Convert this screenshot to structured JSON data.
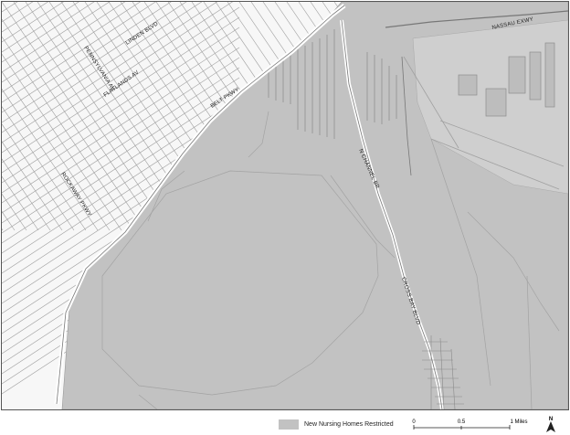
{
  "map": {
    "road_labels": {
      "linden": "LINDEN BLVD",
      "pennsylvania": "PENNSYLVANIA AV",
      "flatlands": "FLATLANDS AV",
      "belt": "BELT PKWY",
      "rockaway": "ROCKAWAY PKWY",
      "nassau": "NASSAU EXWY",
      "channel": "N CHANNEL BR",
      "crossbay": "CROSS BAY BLVD"
    },
    "colors": {
      "restricted_fill": "#c2c2c2",
      "land_fill": "#f7f7f7",
      "street_line": "#9a9a9a"
    }
  },
  "legend": {
    "label": "New Nursing Homes Restricted"
  },
  "scale": {
    "ticks": [
      "0",
      "0.5",
      "1 Miles"
    ]
  },
  "north_arrow": {
    "label": "N"
  }
}
